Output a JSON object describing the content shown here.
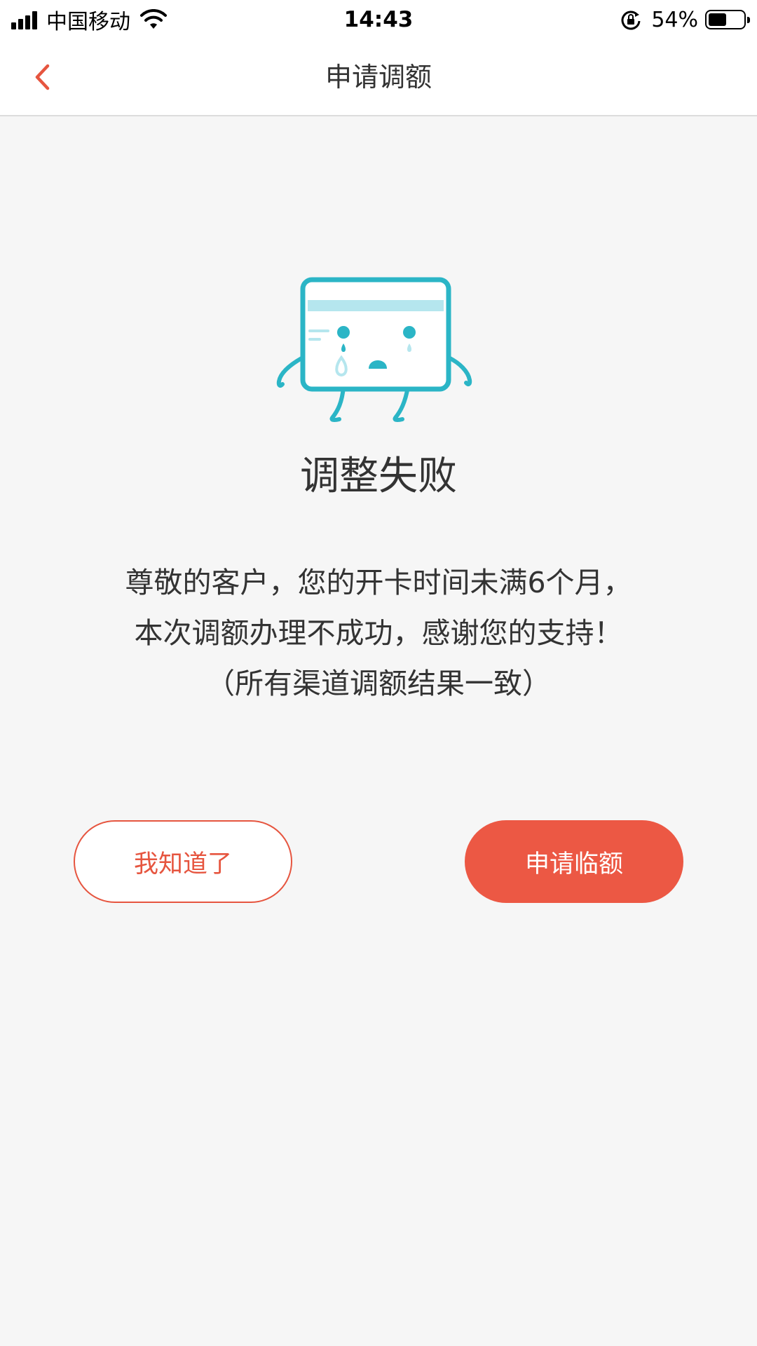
{
  "status_bar": {
    "carrier": "中国移动",
    "time": "14:43",
    "battery_percent": "54%",
    "battery_level": 0.54,
    "icons": [
      "signal-icon",
      "wifi-icon",
      "rotation-lock-icon",
      "battery-icon"
    ]
  },
  "nav": {
    "back_icon": "chevron-left-icon",
    "title": "申请调额"
  },
  "result": {
    "illustration": "crying-card-icon",
    "title": "调整失败",
    "message_lines": [
      "尊敬的客户，您的开卡时间未满6个月，",
      "本次调额办理不成功，感谢您的支持！",
      "（所有渠道调额结果一致）"
    ]
  },
  "actions": {
    "acknowledge_label": "我知道了",
    "temp_limit_label": "申请临额"
  },
  "colors": {
    "accent": "#ec5844",
    "illustration": "#2bb5c6",
    "illustration_light": "#b5e6ee",
    "background": "#f6f6f6"
  }
}
